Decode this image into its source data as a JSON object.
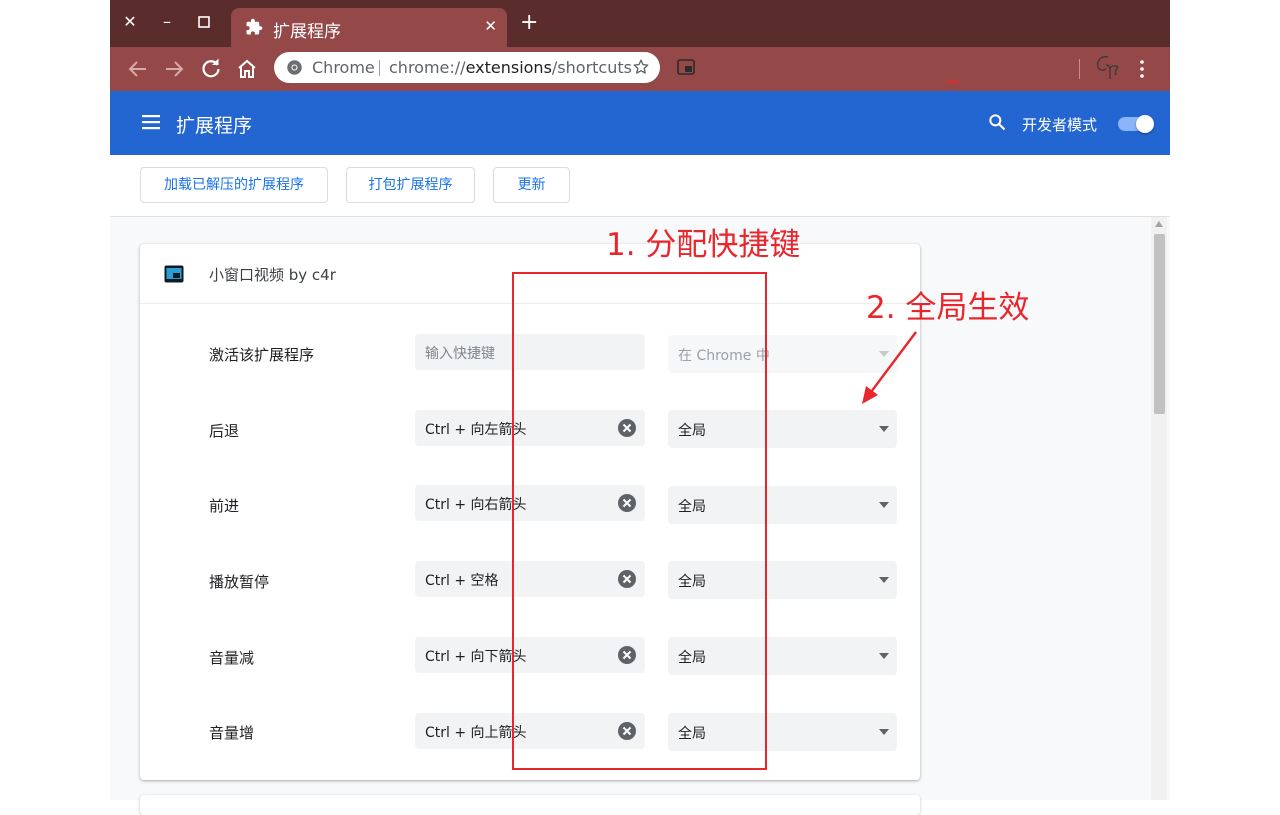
{
  "tab": {
    "title": "扩展程序"
  },
  "omnibox": {
    "site": "Chrome",
    "url_scheme": "chrome://",
    "url_host": "extensions",
    "url_path": "/shortcuts"
  },
  "header": {
    "title": "扩展程序",
    "dev_mode_label": "开发者模式",
    "dev_mode_on": true
  },
  "actions": {
    "load_unpacked": "加载已解压的扩展程序",
    "pack": "打包扩展程序",
    "update": "更新"
  },
  "extension": {
    "name": "小窗口视频 by c4r",
    "commands": [
      {
        "label": "激活该扩展程序",
        "shortcut": "",
        "placeholder": "输入快捷键",
        "scope": "在 Chrome 中"
      },
      {
        "label": "后退",
        "shortcut": "Ctrl + 向左箭头",
        "scope": "全局"
      },
      {
        "label": "前进",
        "shortcut": "Ctrl + 向右箭头",
        "scope": "全局"
      },
      {
        "label": "播放暂停",
        "shortcut": "Ctrl + 空格",
        "scope": "全局"
      },
      {
        "label": "音量减",
        "shortcut": "Ctrl + 向下箭头",
        "scope": "全局"
      },
      {
        "label": "音量增",
        "shortcut": "Ctrl + 向上箭头",
        "scope": "全局"
      }
    ]
  },
  "annotations": {
    "step1": "1. 分配快捷键",
    "step2": "2. 全局生效"
  },
  "colors": {
    "titlebar": "#5b2c2c",
    "toolbar": "#944848",
    "header": "#2366d1",
    "accent": "#1a73e8",
    "annotation": "#e8262b"
  }
}
